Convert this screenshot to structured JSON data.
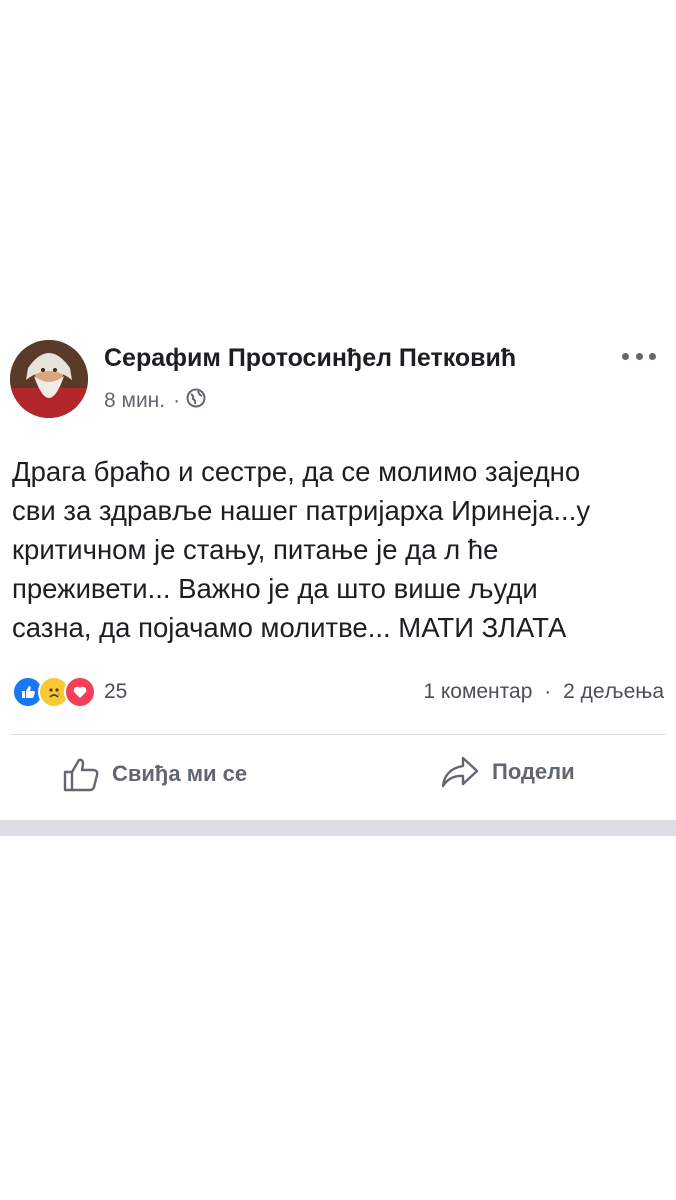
{
  "post": {
    "author": "Серафим Протосинђел Петковић",
    "time": "8 мин.",
    "separator": "·",
    "privacy_icon": "globe-icon",
    "more_icon": "more-dots-icon",
    "text_lines": [
      "Драга браћо и сестре, да се молимо заједно",
      "сви за здравље нашег патријарха Иринеја...у",
      "критичном је стању, питање је да л ће",
      "преживети... Важно је да што више људи",
      "сазна, да појачамо молитве... МАТИ ЗЛАТА"
    ],
    "reactions": {
      "icons": [
        "like-reaction-icon",
        "sad-reaction-icon",
        "love-reaction-icon"
      ],
      "count": "25"
    },
    "comments": "1 коментар",
    "shares": "2 дељења",
    "actions": {
      "like": "Свиђа ми се",
      "share": "Подели"
    }
  },
  "colors": {
    "text": "#1c1e21",
    "secondary": "#616770",
    "like_blue": "#1877f2",
    "sad_yellow": "#f7c935",
    "love_red": "#f33e58",
    "divider": "#dadde1"
  }
}
